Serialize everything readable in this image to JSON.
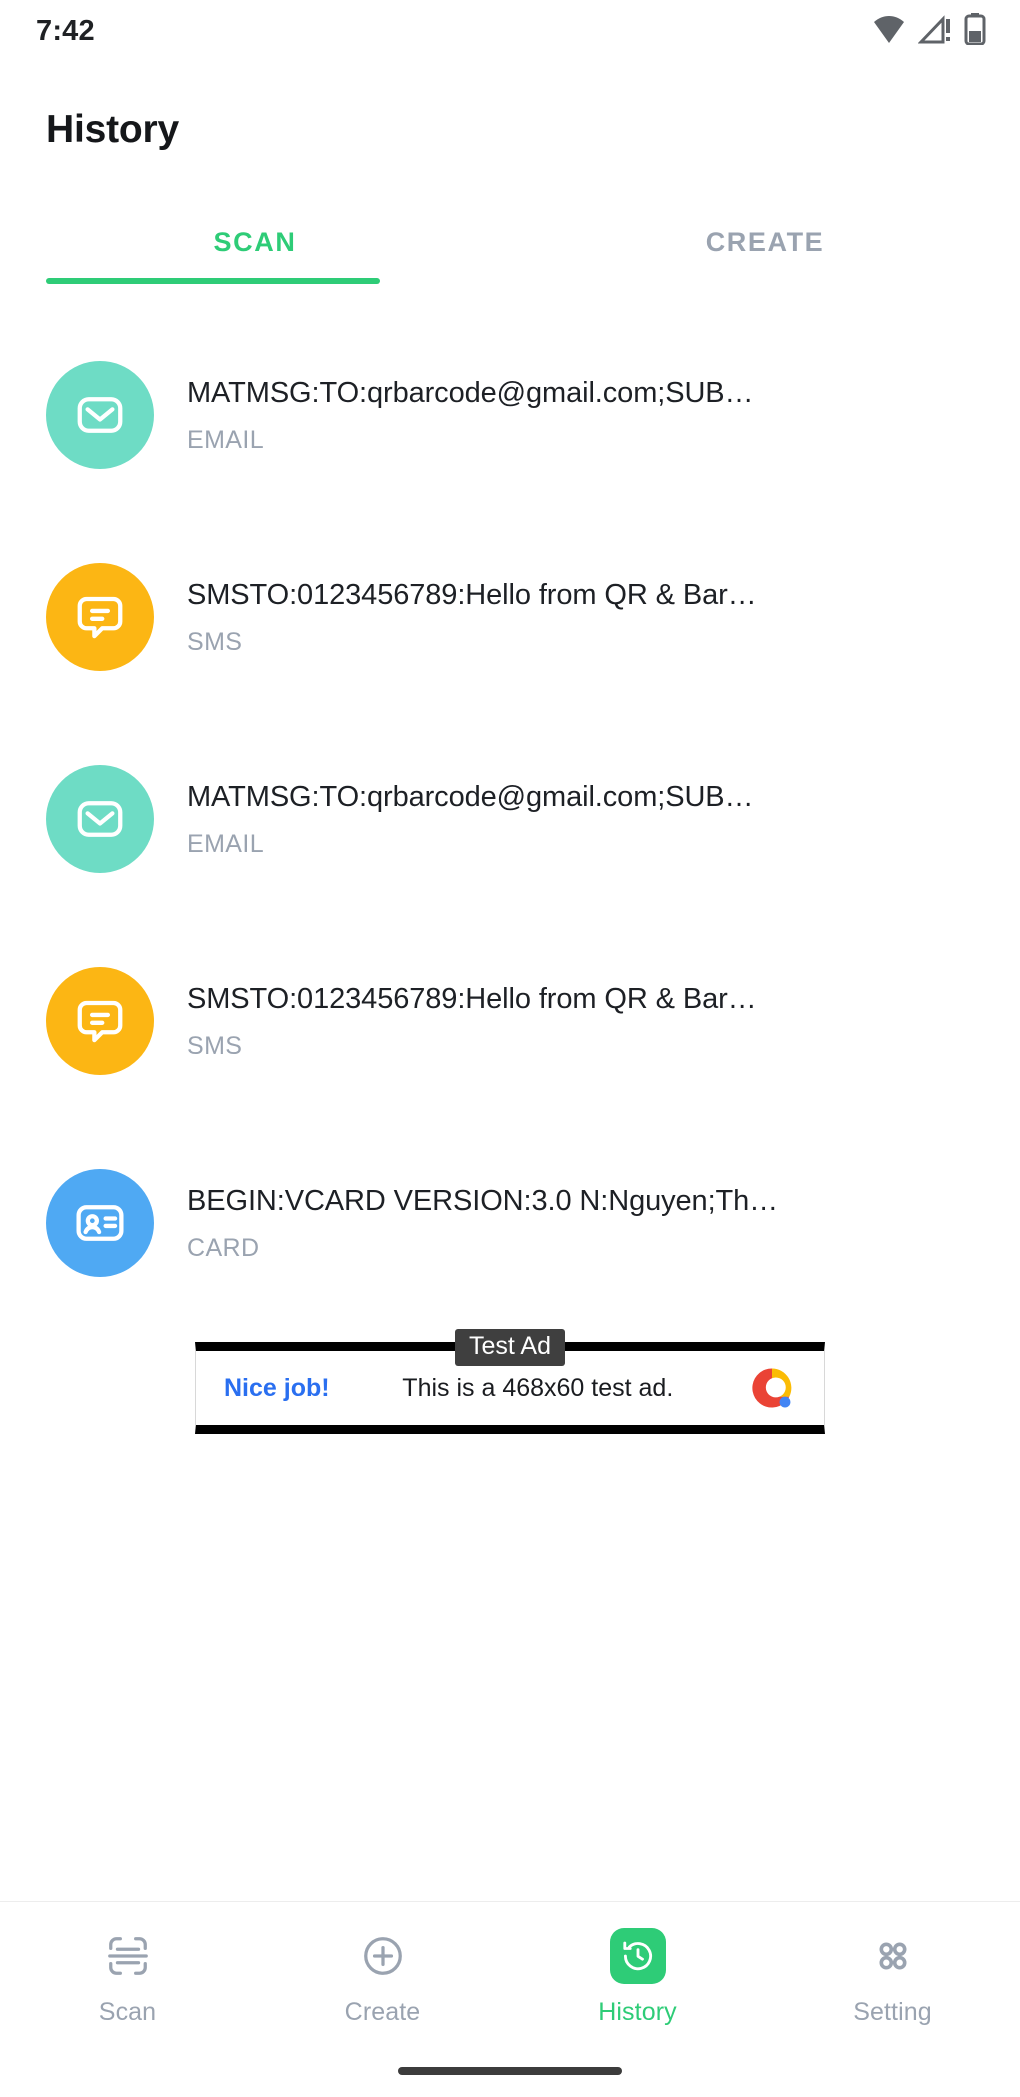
{
  "statusbar": {
    "time": "7:42",
    "icons": [
      "wifi-icon",
      "cellular-no-signal-icon",
      "battery-icon"
    ]
  },
  "header": {
    "title": "History"
  },
  "tabs": {
    "items": [
      {
        "label": "SCAN",
        "active": true
      },
      {
        "label": "CREATE",
        "active": false
      }
    ],
    "active_color": "#2ECC77",
    "inactive_color": "#9AA3B0"
  },
  "list": {
    "items": [
      {
        "title": "MATMSG:TO:qrbarcode@gmail.com;SUB…",
        "type": "EMAIL",
        "icon": "envelope-icon",
        "color": "#6EDCC5"
      },
      {
        "title": "SMSTO:0123456789:Hello from QR & Bar…",
        "type": "SMS",
        "icon": "message-bubble-icon",
        "color": "#FCB614"
      },
      {
        "title": "MATMSG:TO:qrbarcode@gmail.com;SUB…",
        "type": "EMAIL",
        "icon": "envelope-icon",
        "color": "#6EDCC5"
      },
      {
        "title": "SMSTO:0123456789:Hello from QR & Bar…",
        "type": "SMS",
        "icon": "message-bubble-icon",
        "color": "#FCB614"
      },
      {
        "title": "BEGIN:VCARD VERSION:3.0 N:Nguyen;Th…",
        "type": "CARD",
        "icon": "contact-card-icon",
        "color": "#4FA9F3"
      }
    ]
  },
  "ad": {
    "badge": "Test Ad",
    "link_text": "Nice job!",
    "body_text": "This is a 468x60 test ad.",
    "logo": "admob-logo-icon"
  },
  "bottom_nav": {
    "items": [
      {
        "label": "Scan",
        "icon": "scan-frame-icon",
        "active": false
      },
      {
        "label": "Create",
        "icon": "plus-circle-icon",
        "active": false
      },
      {
        "label": "History",
        "icon": "history-clock-icon",
        "active": true
      },
      {
        "label": "Setting",
        "icon": "grid-dots-icon",
        "active": false
      }
    ]
  }
}
